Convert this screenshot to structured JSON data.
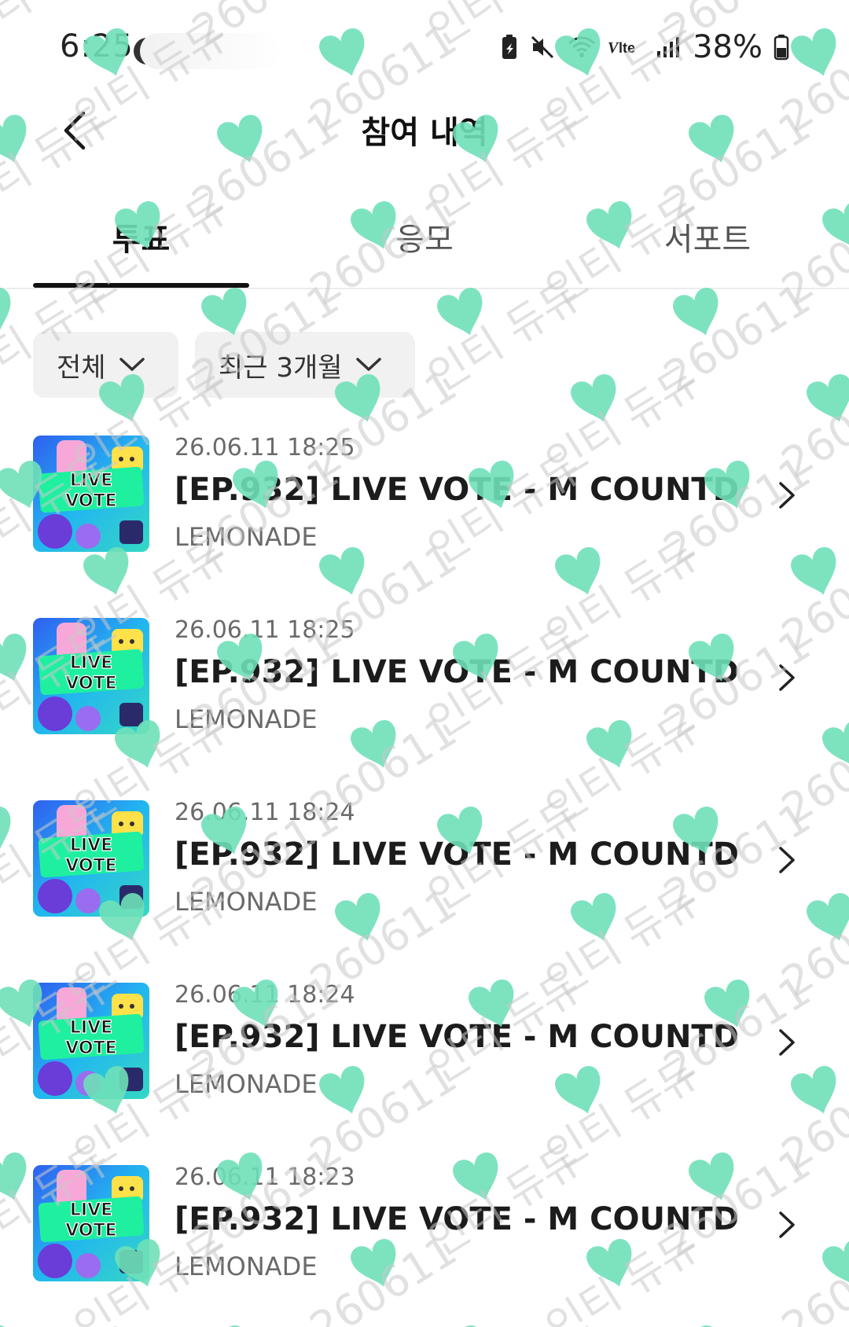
{
  "status_bar": {
    "time": "6:25",
    "battery_text": "38%",
    "icons": [
      "battery-saver-icon",
      "mute-icon",
      "wifi-call-icon",
      "volte-icon",
      "signal-icon",
      "battery-icon"
    ]
  },
  "header": {
    "title": "참여 내역",
    "back_icon": "chevron-left-icon"
  },
  "tabs": [
    {
      "label": "투표",
      "active": true
    },
    {
      "label": "응모",
      "active": false
    },
    {
      "label": "서포트",
      "active": false
    }
  ],
  "filters": [
    {
      "label": "전체",
      "icon": "chevron-down-icon"
    },
    {
      "label": "최근 3개월",
      "icon": "chevron-down-icon"
    }
  ],
  "items": [
    {
      "date": "26.06.11 18:25",
      "title": "[EP.932] LIVE VOTE - M COUNTDO...",
      "subtitle": "LEMONADE",
      "thumb_text": [
        "LIVE",
        "VOTE"
      ]
    },
    {
      "date": "26.06.11 18:25",
      "title": "[EP.932] LIVE VOTE - M COUNTDO...",
      "subtitle": "LEMONADE",
      "thumb_text": [
        "LIVE",
        "VOTE"
      ]
    },
    {
      "date": "26.06.11 18:24",
      "title": "[EP.932] LIVE VOTE - M COUNTDO...",
      "subtitle": "LEMONADE",
      "thumb_text": [
        "LIVE",
        "VOTE"
      ]
    },
    {
      "date": "26.06.11 18:24",
      "title": "[EP.932] LIVE VOTE - M COUNTDO...",
      "subtitle": "LEMONADE",
      "thumb_text": [
        "LIVE",
        "VOTE"
      ]
    },
    {
      "date": "26.06.11 18:23",
      "title": "[EP.932] LIVE VOTE - M COUNTDO...",
      "subtitle": "LEMONADE",
      "thumb_text": [
        "LIVE",
        "VOTE"
      ]
    }
  ],
  "watermark": {
    "texts": [
      "260611",
      "인티 듀듀"
    ],
    "color": "#c9c9c9",
    "heart_color": "#6fe0b8",
    "icon": "heart-icon"
  }
}
